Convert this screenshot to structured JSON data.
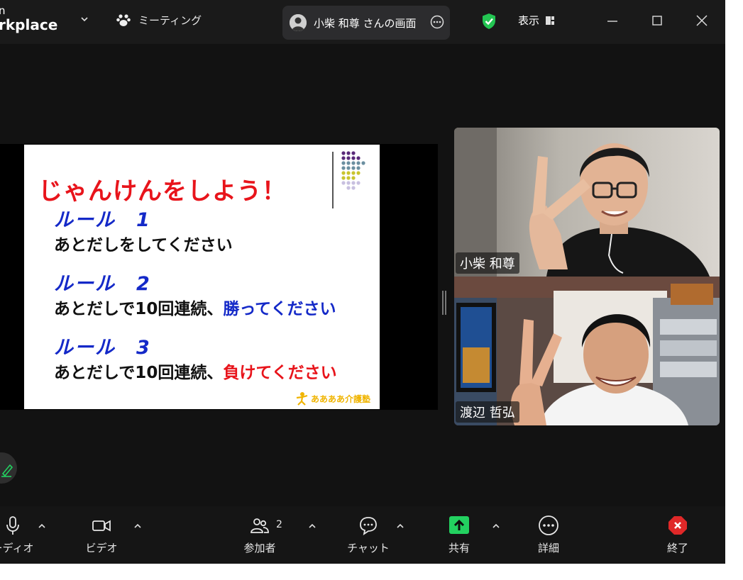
{
  "app": {
    "brand_line1": "n",
    "brand_line2": "rkplace"
  },
  "titlebar": {
    "meeting_label": "ミーティング",
    "share_pill_label": "小柴 和尊 さんの画面",
    "view_label": "表示"
  },
  "slide": {
    "title": "じゃんけんをしよう！",
    "rule1_heading": "ルール　1",
    "rule1_text": "あとだしをしてください",
    "rule2_heading": "ルール　2",
    "rule2_text_a": "あとだしで10回連続、",
    "rule2_text_b": "勝ってください",
    "rule3_heading": "ルール　3",
    "rule3_text_a": "あとだしで10回連続、",
    "rule3_text_b": "負けてください",
    "footer": "ああああ介護塾"
  },
  "participants": [
    {
      "name": "小柴 和尊"
    },
    {
      "name": "渡辺 哲弘"
    }
  ],
  "toolbar": {
    "audio_label": "ーディオ",
    "video_label": "ビデオ",
    "participants_label": "参加者",
    "participants_count": "2",
    "chat_label": "チャット",
    "share_label": "共有",
    "more_label": "詳細",
    "end_label": "終了"
  },
  "colors": {
    "share_green": "#23d160",
    "end_red": "#e02828",
    "shield_green": "#23c552",
    "slide_red": "#e8141b",
    "slide_blue": "#1429c8"
  },
  "icons": [
    "chevron-down-icon",
    "paw-icon",
    "more-icon",
    "shield-check-icon",
    "view-grid-icon",
    "minimize-icon",
    "maximize-icon",
    "close-icon",
    "mic-icon",
    "video-icon",
    "participants-icon",
    "chat-icon",
    "share-arrow-icon",
    "more-circle-icon",
    "end-hexagon-icon",
    "annotate-pen-icon"
  ]
}
